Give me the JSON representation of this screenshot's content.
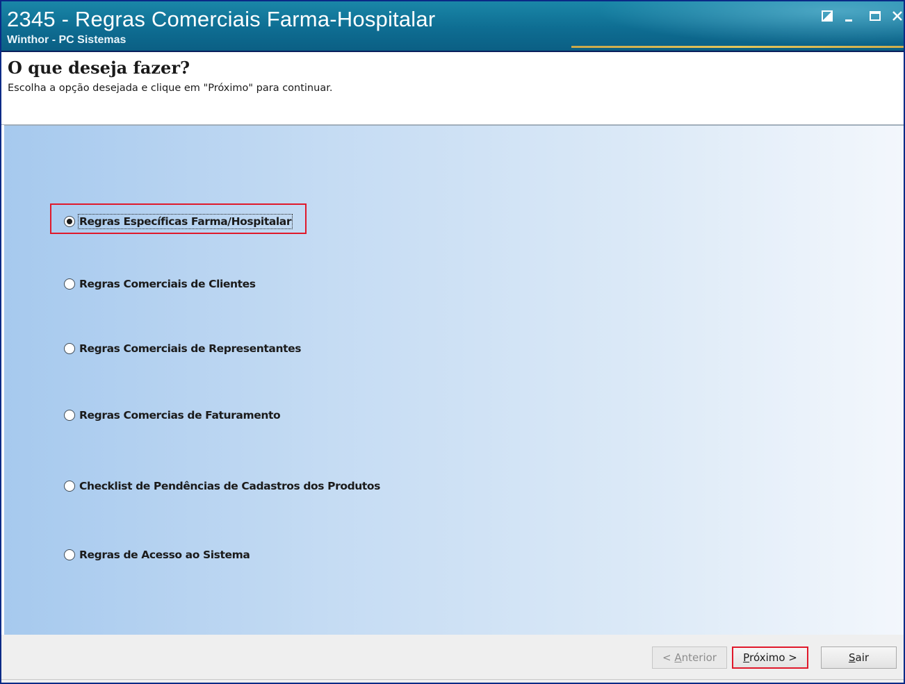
{
  "window": {
    "title": "2345 - Regras Comerciais Farma-Hospitalar",
    "subtitle": "Winthor - PC Sistemas",
    "controls": [
      "restore-icon",
      "minimize-icon",
      "maximize-icon",
      "close-icon"
    ],
    "colors": {
      "titlebar": "#0e6d92",
      "accent": "#e5c65a",
      "border": "#0a2a86"
    }
  },
  "header": {
    "title": "O que deseja fazer?",
    "instructions": "Escolha a opção desejada e clique em \"Próximo\" para continuar."
  },
  "options": [
    {
      "label": "Regras Específicas Farma/Hospitalar",
      "selected": true
    },
    {
      "label": "Regras Comerciais de Clientes",
      "selected": false
    },
    {
      "label": "Regras Comerciais de Representantes",
      "selected": false
    },
    {
      "label": "Regras Comercias de Faturamento",
      "selected": false
    },
    {
      "label": "Checklist de Pendências de Cadastros dos Produtos",
      "selected": false
    },
    {
      "label": "Regras de Acesso ao Sistema",
      "selected": false
    }
  ],
  "buttons": {
    "prev": {
      "prefix": "< ",
      "mnemonic": "A",
      "rest": "nterior",
      "enabled": false
    },
    "next": {
      "mnemonic": "P",
      "rest": "róximo >",
      "enabled": true
    },
    "exit": {
      "mnemonic": "S",
      "rest": "air",
      "enabled": true
    }
  },
  "highlight_color": "#e0182a"
}
